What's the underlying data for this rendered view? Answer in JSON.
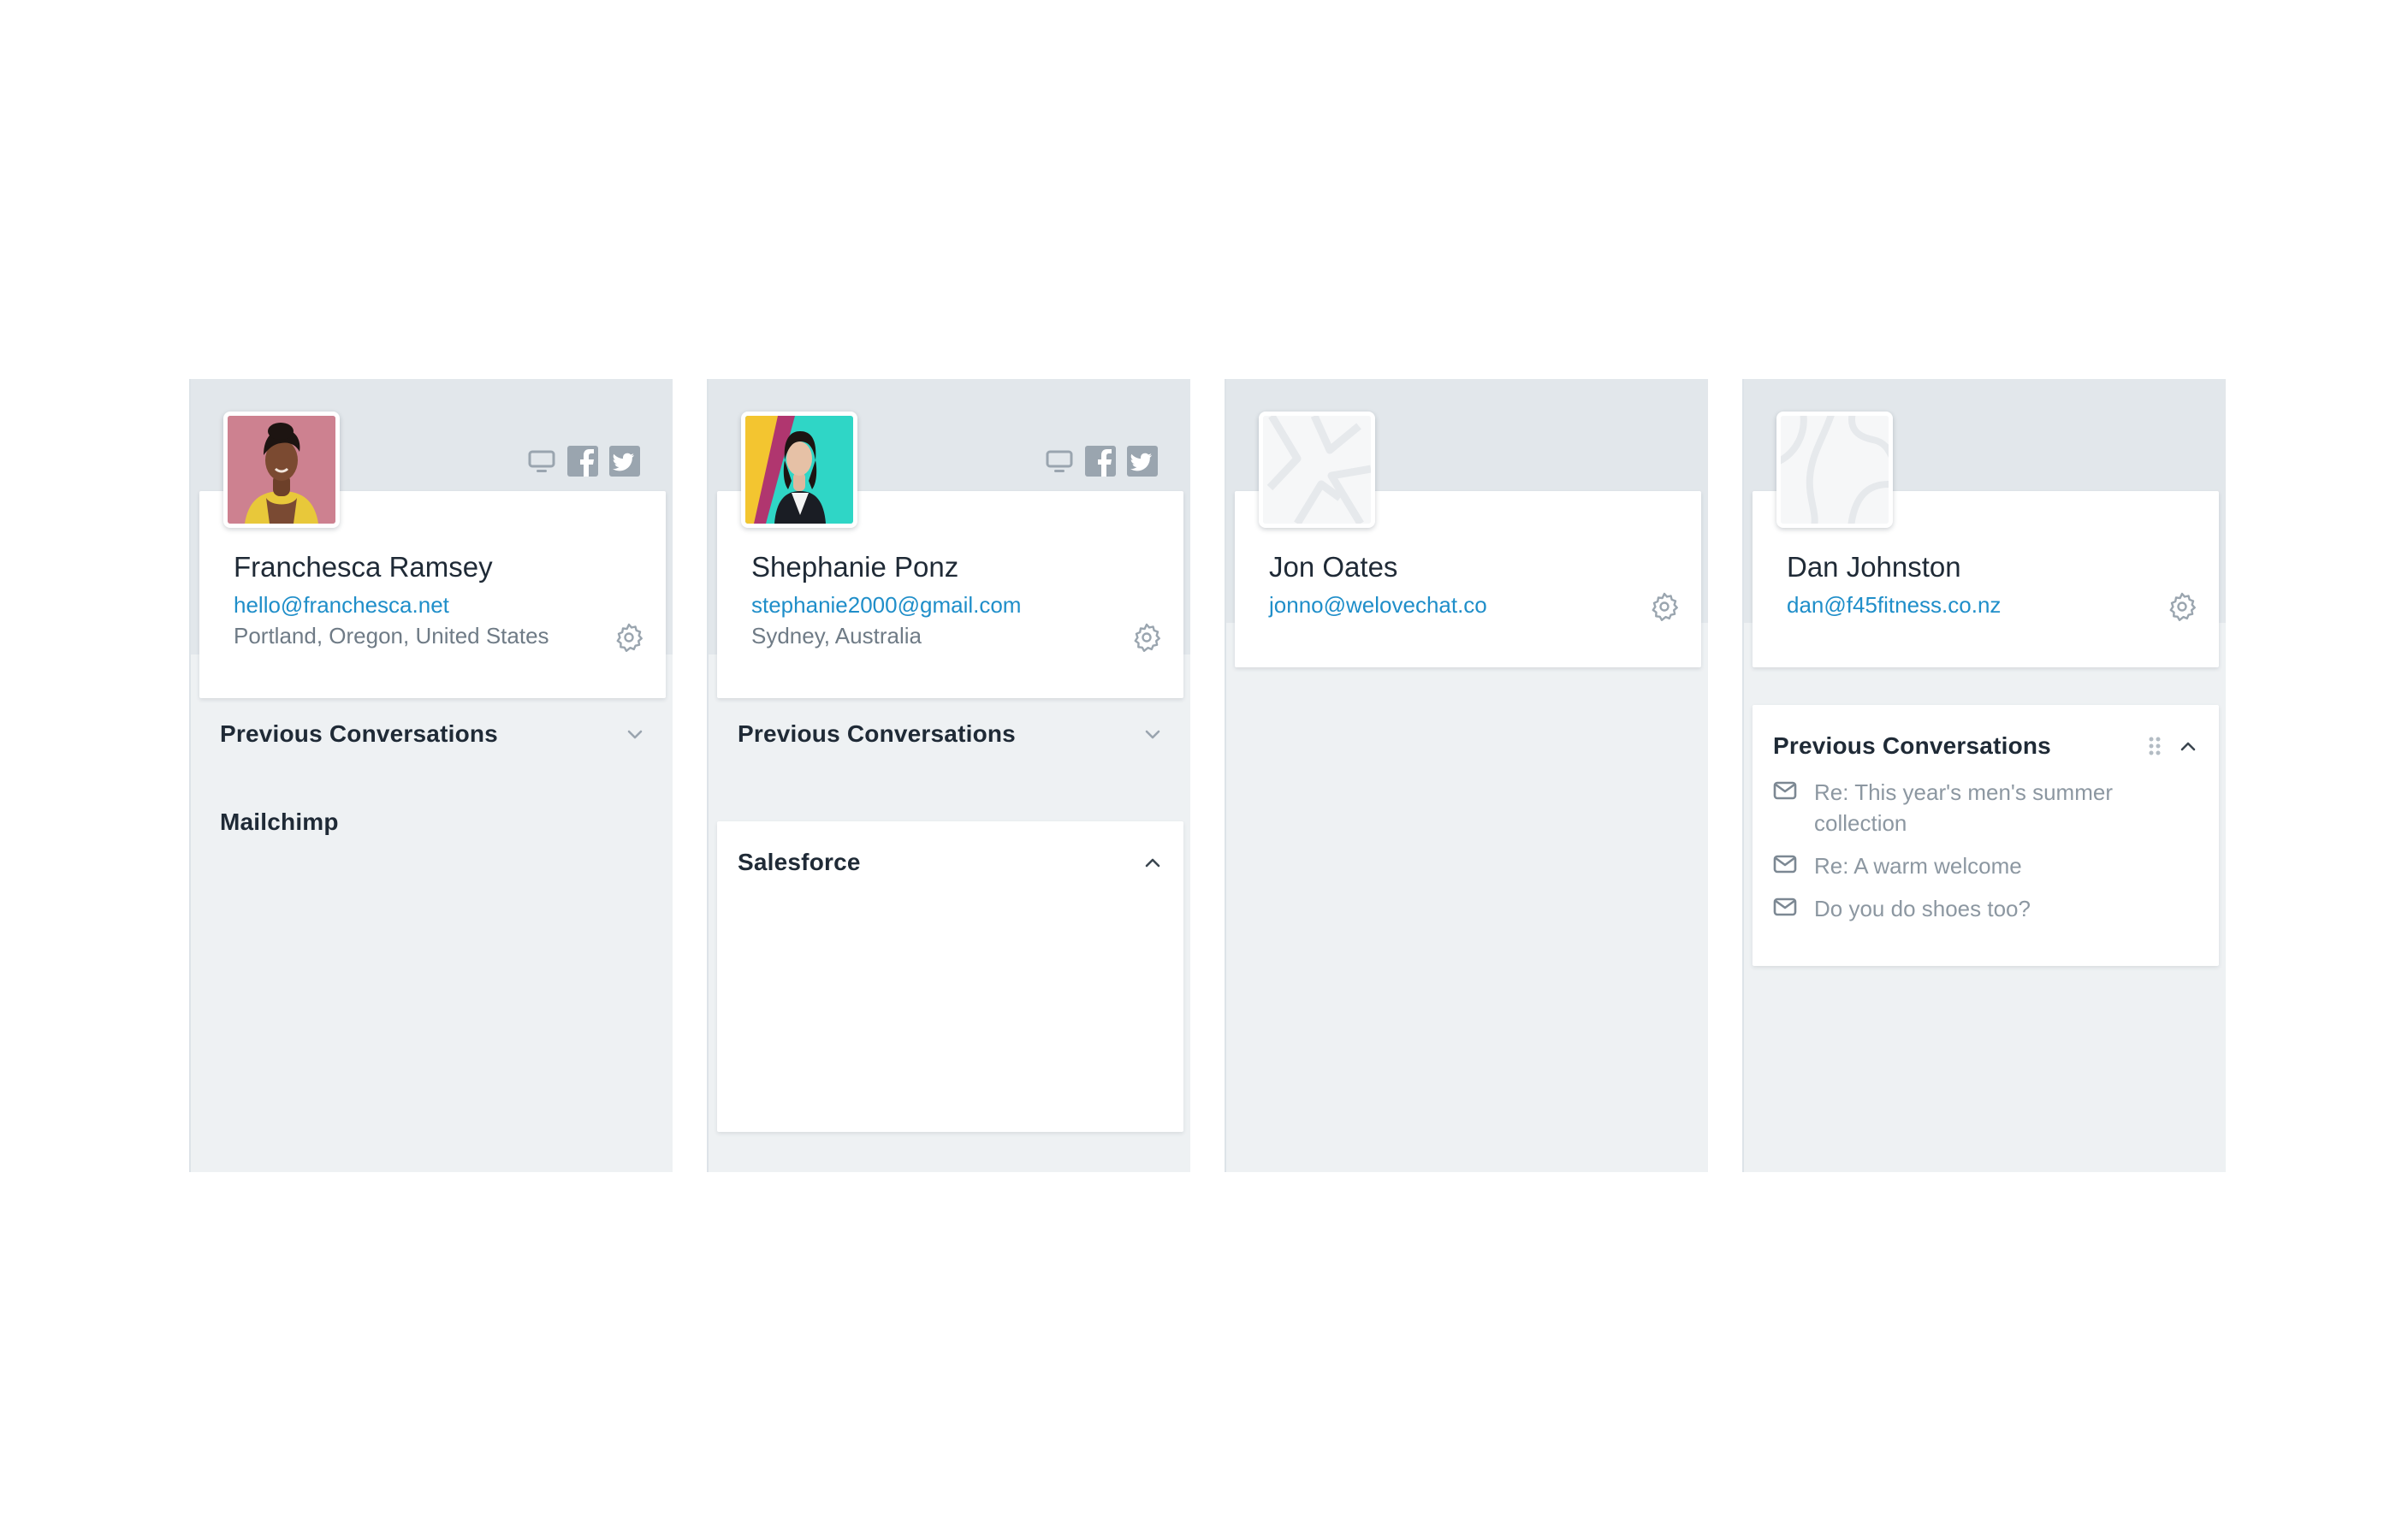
{
  "colors": {
    "panel_bg": "#eef1f3",
    "panel_header_bg": "#e2e7eb",
    "link": "#1f8ec9",
    "muted_text": "#6f7b86",
    "icon_gray": "#9aa5af"
  },
  "panels": [
    {
      "name": "Franchesca Ramsey",
      "email": "hello@franchesca.net",
      "location": "Portland, Oregon, United States",
      "social_icons": [
        "monitor-icon",
        "facebook-icon",
        "twitter-icon"
      ],
      "sections": [
        {
          "title": "Previous Conversations",
          "state": "collapsed"
        },
        {
          "title": "Mailchimp",
          "state": "collapsed"
        }
      ]
    },
    {
      "name": "Shephanie Ponz",
      "email": "stephanie2000@gmail.com",
      "location": "Sydney, Australia",
      "social_icons": [
        "monitor-icon",
        "facebook-icon",
        "twitter-icon"
      ],
      "sections": [
        {
          "title": "Previous Conversations",
          "state": "collapsed"
        },
        {
          "title": "Salesforce",
          "state": "expanded"
        }
      ]
    },
    {
      "name": "Jon Oates",
      "email": "jonno@welovechat.co"
    },
    {
      "name": "Dan Johnston",
      "email": "dan@f45fitness.co.nz",
      "sections": [
        {
          "title": "Previous Conversations",
          "state": "expanded",
          "items": [
            "Re: This year's men's summer collection",
            "Re: A warm welcome",
            "Do you do shoes too?"
          ]
        }
      ]
    }
  ]
}
